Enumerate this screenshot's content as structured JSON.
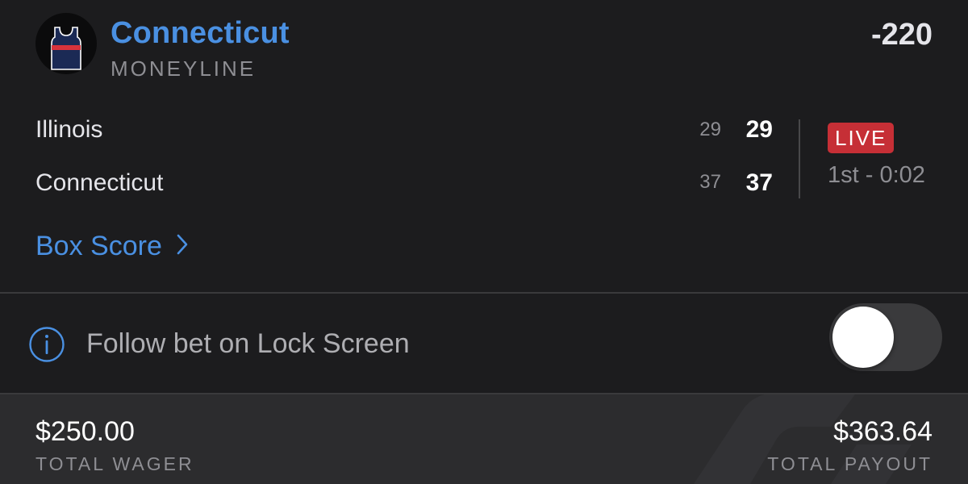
{
  "bet": {
    "pick": "Connecticut",
    "type": "MONEYLINE",
    "odds": "-220",
    "team_icon": "basketball-jersey-icon"
  },
  "game": {
    "teams": [
      {
        "name": "Illinois",
        "period_score": "29",
        "total_score": "29"
      },
      {
        "name": "Connecticut",
        "period_score": "37",
        "total_score": "37"
      }
    ],
    "status_badge": "LIVE",
    "clock": "1st - 0:02"
  },
  "box_score": {
    "label": "Box Score",
    "icon": "chevron-right-icon"
  },
  "lock_screen": {
    "label": "Follow bet on Lock Screen",
    "icon": "info-icon",
    "toggle_on": false
  },
  "totals": {
    "wager_amount": "$250.00",
    "wager_label": "TOTAL WAGER",
    "payout_amount": "$363.64",
    "payout_label": "TOTAL PAYOUT"
  },
  "colors": {
    "accent": "#4a90e2",
    "live": "#c62f36",
    "background": "#1c1c1e",
    "footer": "#2c2c2e"
  }
}
